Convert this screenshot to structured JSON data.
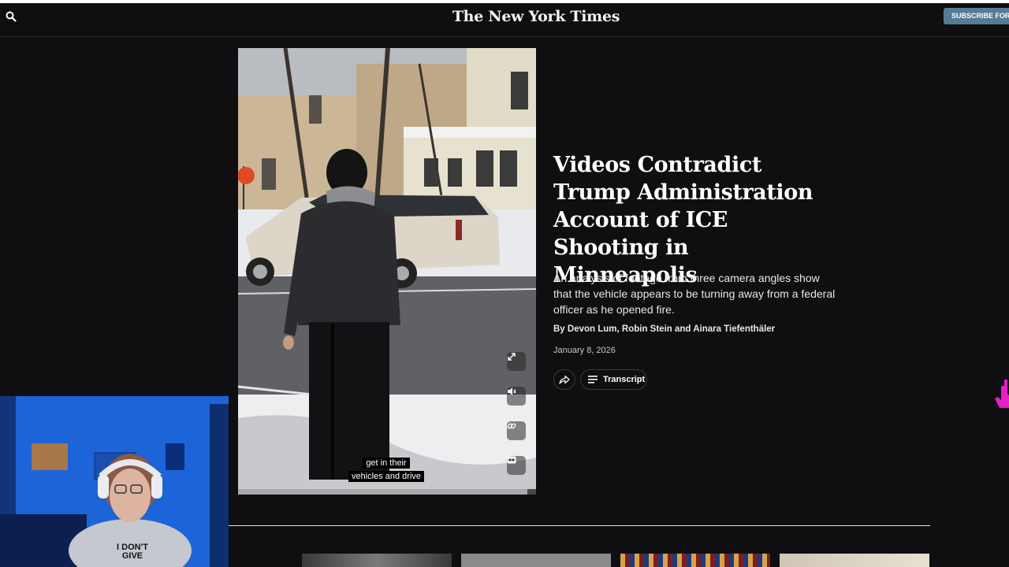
{
  "header": {
    "logo": "The New York Times",
    "subscribe_label": "SUBSCRIBE FOR $",
    "icons": {
      "search": "search-icon"
    }
  },
  "video": {
    "caption_line1": "get in their",
    "caption_line2": "vehicles and drive",
    "controls": [
      "expand-icon",
      "volume-icon",
      "link-icon",
      "captions-icon"
    ],
    "progress": 0.97
  },
  "article": {
    "headline": "Videos Contradict Trump Administration Account of ICE Shooting in Minneapolis",
    "summary": "An analysis of footage from three camera angles show that the vehicle appears to be turning away from a federal officer as he opened fire.",
    "byline": "By Devon Lum, Robin Stein and Ainara Tiefenthäler",
    "date": "January 8, 2026",
    "transcript_label": "Transcript"
  },
  "webcam": {
    "shirt_text_line1": "I DON'T",
    "shirt_text_line2": "GIVE"
  },
  "colors": {
    "background": "#0f0e10",
    "subscribe": "#567b95",
    "webcam_wall": "#1d64d8",
    "cursor": "#e81ec8"
  }
}
